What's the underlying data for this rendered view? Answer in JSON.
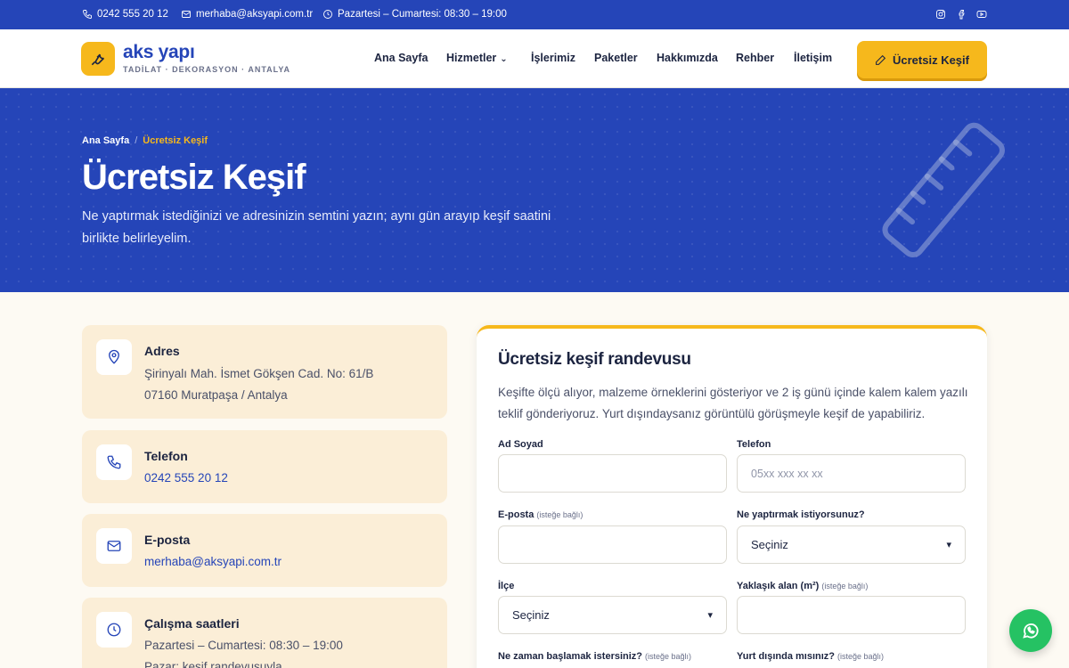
{
  "topbar": {
    "phone": "0242 555 20 12",
    "email": "merhaba@aksyapi.com.tr",
    "hours": "Pazartesi – Cumartesi: 08:30 – 19:00",
    "social_icons": [
      "instagram-icon",
      "facebook-icon",
      "youtube-icon"
    ]
  },
  "header": {
    "logo_name": "aks yapı",
    "logo_tagline": "TADİLAT · DEKORASYON · ANTALYA",
    "nav": [
      "Ana Sayfa",
      "Hizmetler",
      "İşlerimiz",
      "Paketler",
      "Hakkımızda",
      "Rehber",
      "İletişim"
    ],
    "cta_label": "Ücretsiz Keşif"
  },
  "hero": {
    "breadcrumb_home": "Ana Sayfa",
    "breadcrumb_sep": "/",
    "breadcrumb_current": "Ücretsiz Keşif",
    "title": "Ücretsiz Keşif",
    "subtitle": "Ne yaptırmak istediğinizi ve adresinizin semtini yazın; aynı gün arayıp keşif saatini birlikte belirleyelim."
  },
  "info": {
    "address": {
      "title": "Adres",
      "line1": "Şirinyalı Mah. İsmet Gökşen Cad. No: 61/B",
      "line2": "07160 Muratpaşa / Antalya"
    },
    "phone": {
      "title": "Telefon",
      "value": "0242 555 20 12"
    },
    "email": {
      "title": "E-posta",
      "value": "merhaba@aksyapi.com.tr"
    },
    "hours": {
      "title": "Çalışma saatleri",
      "line1": "Pazartesi – Cumartesi: 08:30 – 19:00",
      "line2": "Pazar: keşif randevusuyla"
    }
  },
  "form": {
    "title": "Ücretsiz keşif randevusu",
    "description": "Keşifte ölçü alıyor, malzeme örneklerini gösteriyor ve 2 iş günü içinde kalem kalem yazılı teklif gönderiyoruz. Yurt dışındaysanız görüntülü görüşmeyle keşif de yapabiliriz.",
    "optional_note": "(isteğe bağlı)",
    "name_label": "Ad Soyad",
    "name_value": "",
    "phone_label": "Telefon",
    "phone_placeholder": "05xx xxx xx xx",
    "email_label": "E-posta",
    "email_value": "",
    "service_label": "Ne yaptırmak istiyorsunuz?",
    "service_selected": "Seçiniz",
    "district_label": "İlçe",
    "district_selected": "Seçiniz",
    "area_label": "Yaklaşık alan (m²)",
    "area_value": "",
    "start_label": "Ne zaman başlamak istersiniz?",
    "abroad_label": "Yurt dışında mısınız?"
  },
  "colors": {
    "primary": "#2545b8",
    "accent": "#f6b81c",
    "whatsapp": "#25c263",
    "card_bg": "#fbeed7"
  }
}
